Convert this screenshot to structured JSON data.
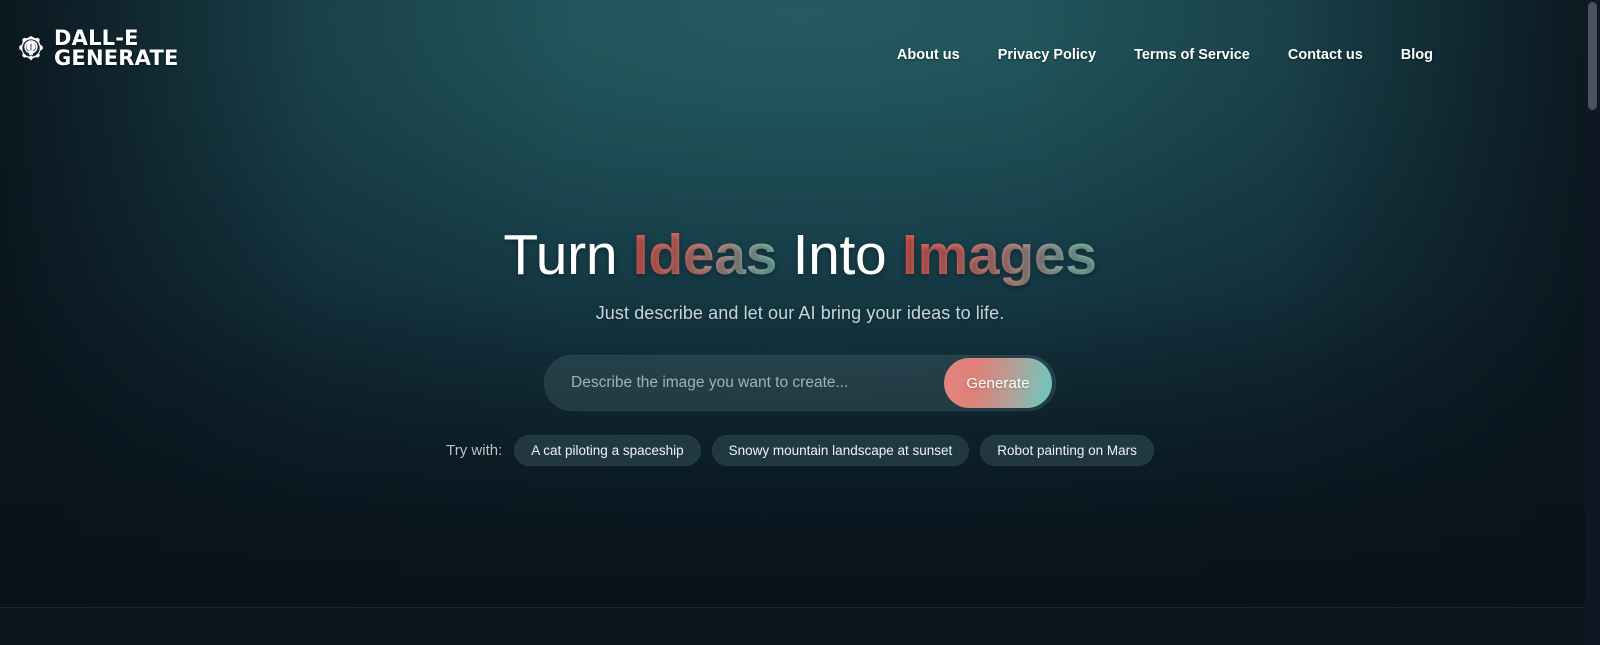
{
  "brand": {
    "icon": "gear-lightbulb-icon",
    "line1": "DALL-E",
    "line2": "GENERATE"
  },
  "nav": {
    "items": [
      {
        "label": "About us"
      },
      {
        "label": "Privacy Policy"
      },
      {
        "label": "Terms of Service"
      },
      {
        "label": "Contact us"
      },
      {
        "label": "Blog"
      }
    ]
  },
  "hero": {
    "headline": {
      "part1": "Turn ",
      "accent1": "Ideas",
      "part2": " Into ",
      "accent2": "Images"
    },
    "subheadline": "Just describe and let our AI bring your ideas to life.",
    "prompt": {
      "value": "",
      "placeholder": "Describe the image you want to create...",
      "button_label": "Generate"
    },
    "suggestions": {
      "label": "Try with:",
      "chips": [
        {
          "label": "A cat piloting a spaceship"
        },
        {
          "label": "Snowy mountain landscape at sunset"
        },
        {
          "label": "Robot painting on Mars"
        }
      ]
    }
  },
  "colors": {
    "background_center": "#265a60",
    "background_edge": "#0b1720",
    "accent_warm": "#ea625c",
    "accent_cool": "#7cc3b4",
    "button_gradient_start": "#e38580",
    "button_gradient_end": "#6cc6bb",
    "text_primary": "#ffffff",
    "text_secondary": "#c9d6d8",
    "chip_background": "#263e46"
  }
}
